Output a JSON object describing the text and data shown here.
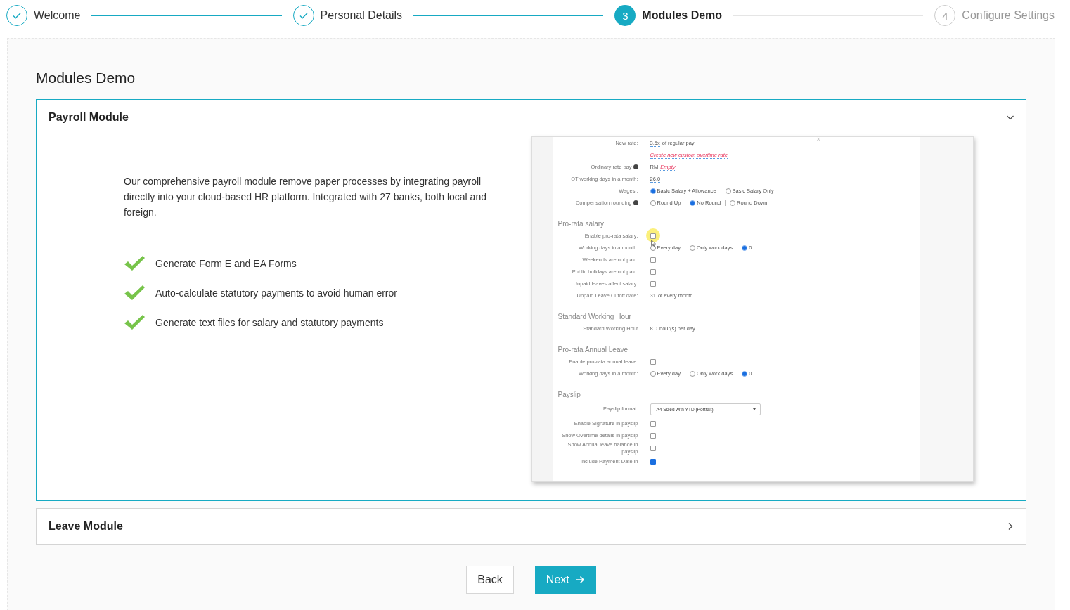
{
  "steps": [
    {
      "label": "Welcome",
      "completed": true,
      "selected": false
    },
    {
      "label": "Personal Details",
      "completed": true,
      "selected": false
    },
    {
      "label": "Modules Demo",
      "number": "3",
      "completed": false,
      "selected": true
    },
    {
      "label": "Configure Settings",
      "number": "4",
      "completed": false,
      "selected": false
    }
  ],
  "page_title": "Modules Demo",
  "modules": [
    {
      "title": "Payroll Module",
      "expanded": true,
      "description": "Our comprehensive payroll module remove paper processes by integrating payroll directly into your cloud-based HR platform. Integrated with 27 banks, both local and foreign.",
      "features": [
        "Generate Form E and EA Forms",
        "Auto-calculate statutory payments to avoid human error",
        "Generate text files for salary and statutory payments"
      ],
      "screenshot": {
        "close_mark": "×",
        "rows": [
          {
            "kind": "field",
            "label": "New rate:",
            "value": "3.5x",
            "suffix": "of regular pay"
          },
          {
            "kind": "link",
            "text": "Create new custom overtime rate"
          },
          {
            "kind": "money",
            "label": "Ordinary rate pay",
            "info": true,
            "prefix": "RM",
            "link": "Empty"
          },
          {
            "kind": "field",
            "label": "OT working days in a month:",
            "value": "26.0"
          },
          {
            "kind": "radios",
            "label": "Wages :",
            "options": [
              {
                "label": "Basic Salary + Allowance",
                "selected": true
              },
              {
                "label": "Basic Salary Only",
                "selected": false
              }
            ]
          },
          {
            "kind": "radios",
            "label": "Compensation rounding",
            "info": true,
            "options": [
              {
                "label": "Round Up",
                "selected": false
              },
              {
                "label": "No Round",
                "selected": true
              },
              {
                "label": "Round Down",
                "selected": false
              }
            ]
          },
          {
            "kind": "heading",
            "text": "Pro-rata salary"
          },
          {
            "kind": "checkbox",
            "label": "Enable pro-rata salary:",
            "checked": false,
            "pointer": true
          },
          {
            "kind": "radios",
            "label": "Working days in a month:",
            "options": [
              {
                "label": "Every day",
                "selected": false
              },
              {
                "label": "Only work days",
                "selected": false
              },
              {
                "label": "0",
                "selected": true
              }
            ]
          },
          {
            "kind": "checkbox",
            "label": "Weekends are not paid:",
            "checked": false
          },
          {
            "kind": "checkbox",
            "label": "Public holidays are not paid:",
            "checked": false
          },
          {
            "kind": "checkbox",
            "label": "Unpaid leaves affect salary:",
            "checked": false
          },
          {
            "kind": "field",
            "label": "Unpaid Leave Cutoff date:",
            "value": "31",
            "suffix": "of every month"
          },
          {
            "kind": "heading",
            "text": "Standard Working Hour"
          },
          {
            "kind": "field",
            "label": "Standard Working Hour",
            "value": "8.0",
            "suffix": "hour(s) per day"
          },
          {
            "kind": "heading",
            "text": "Pro-rata Annual Leave"
          },
          {
            "kind": "checkbox",
            "label": "Enable pro-rata annual leave:",
            "checked": false
          },
          {
            "kind": "radios",
            "label": "Working days in a month:",
            "options": [
              {
                "label": "Every day",
                "selected": false
              },
              {
                "label": "Only work days",
                "selected": false
              },
              {
                "label": "0",
                "selected": true
              }
            ]
          },
          {
            "kind": "heading",
            "text": "Payslip"
          },
          {
            "kind": "select",
            "label": "Payslip format:",
            "value": "A4 Sized with YTD (Portrait)"
          },
          {
            "kind": "checkbox",
            "label": "Enable Signature in payslip",
            "checked": false
          },
          {
            "kind": "checkbox",
            "label": "Show Overtime details in payslip",
            "checked": false
          },
          {
            "kind": "checkbox",
            "label": "Show Annual leave balance in payslip",
            "checked": false
          },
          {
            "kind": "checkbox",
            "label": "Include Payment Date in",
            "checked": true
          }
        ]
      }
    },
    {
      "title": "Leave Module",
      "expanded": false
    }
  ],
  "buttons": [
    {
      "label": "Back",
      "kind": "secondary"
    },
    {
      "label": "Next",
      "kind": "primary"
    }
  ]
}
